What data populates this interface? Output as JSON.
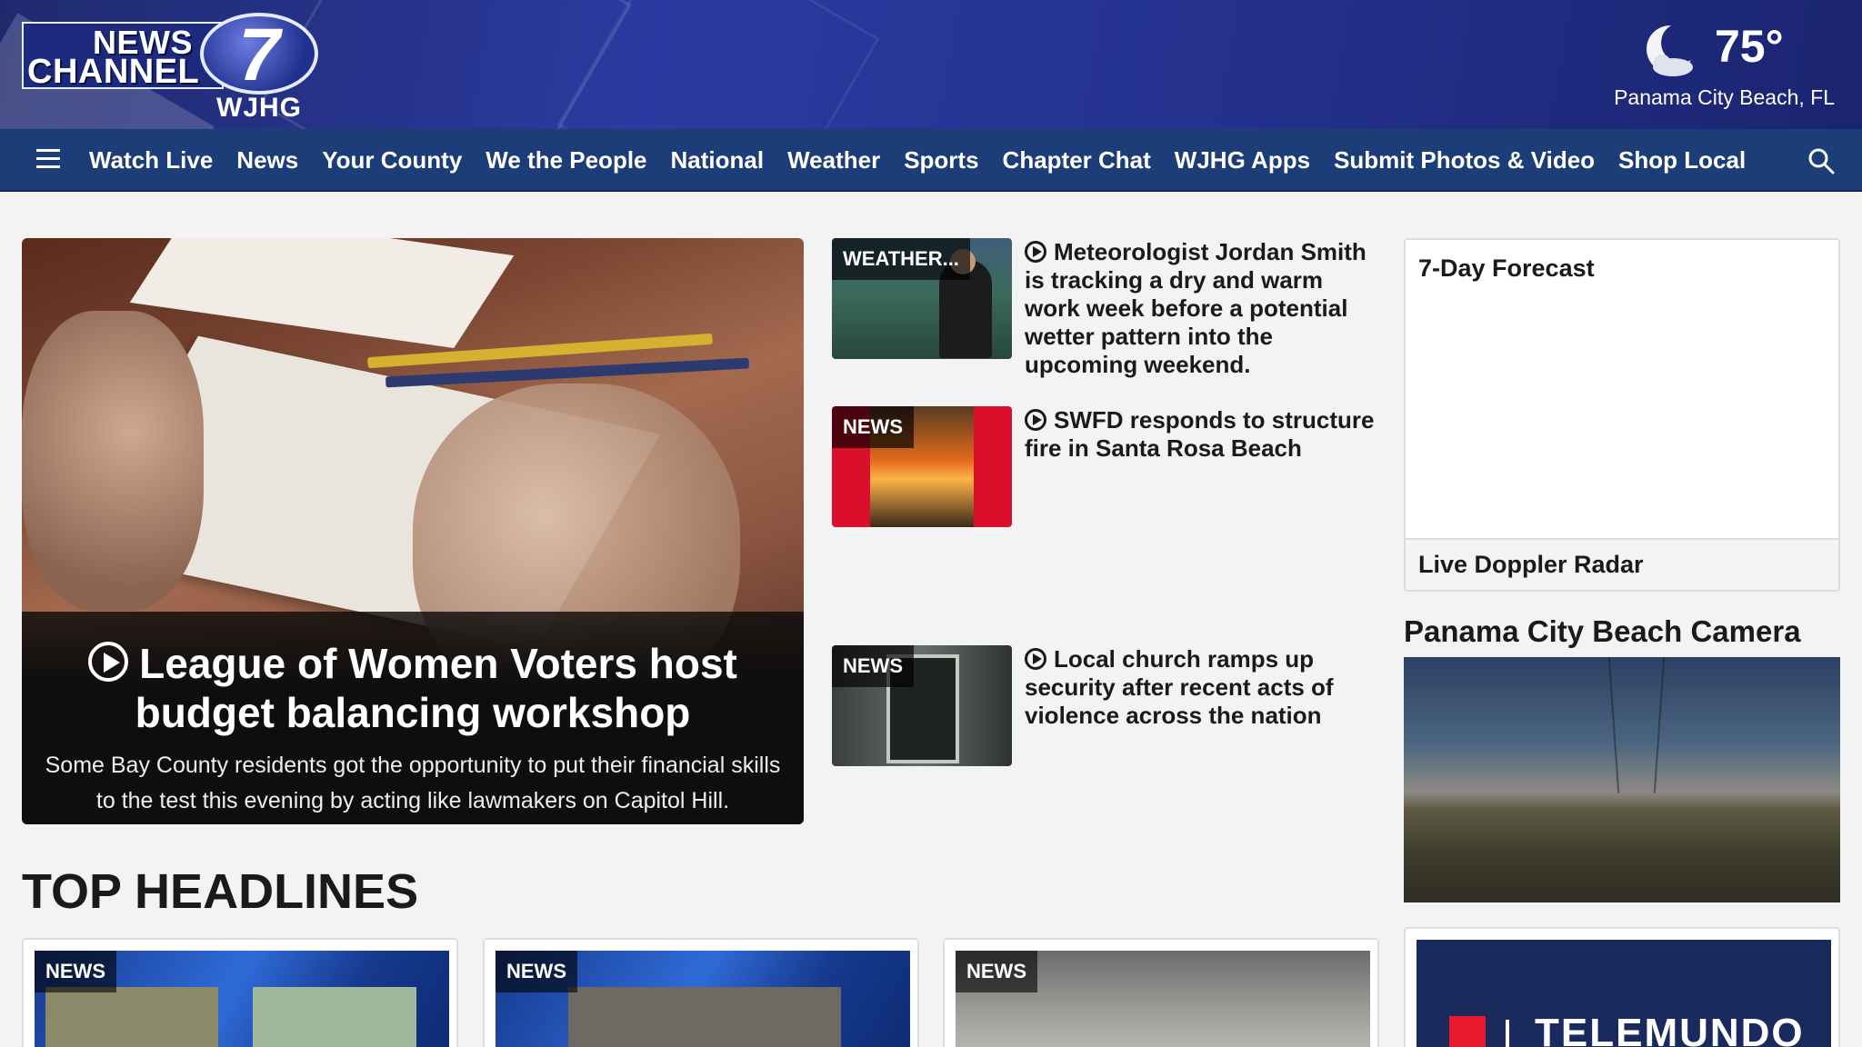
{
  "header": {
    "logo": {
      "line1": "NEWS",
      "line2": "CHANNEL",
      "number": "7",
      "callsign": "WJHG"
    },
    "weather": {
      "temperature": "75°",
      "location": "Panama City Beach, FL",
      "icon": "moon-cloud-icon"
    }
  },
  "nav": {
    "menu_icon": "hamburger-menu-icon",
    "items": [
      "Watch Live",
      "News",
      "Your County",
      "We the People",
      "National",
      "Weather",
      "Sports",
      "Chapter Chat",
      "WJHG Apps",
      "Submit Photos & Video",
      "Shop Local"
    ],
    "search_icon": "search-icon"
  },
  "hero": {
    "title": "League of Women Voters host budget balancing workshop",
    "summary": "Some Bay County residents got the opportunity to put their financial skills to the test this evening by acting like lawmakers on Capitol Hill.",
    "icon": "play-circle-icon"
  },
  "stories": [
    {
      "tag": "WEATHER...",
      "title": "Meteorologist Jordan Smith is tracking a dry and warm work week before a potential wetter pattern into the upcoming weekend."
    },
    {
      "tag": "NEWS",
      "title": "SWFD responds to structure fire in Santa Rosa Beach"
    },
    {
      "tag": "NEWS",
      "title": "Local church ramps up security after recent acts of violence across the nation"
    }
  ],
  "sidebar": {
    "forecast_title": "7-Day Forecast",
    "radar_label": "Live Doppler Radar",
    "camera_title": "Panama City Beach Camera"
  },
  "top_headlines": {
    "title": "TOP HEADLINES",
    "cards": [
      {
        "tag": "NEWS"
      },
      {
        "tag": "NEWS"
      },
      {
        "tag": "NEWS"
      }
    ],
    "telemundo": "TELEMUNDO"
  },
  "colors": {
    "nav": "#1c3d78",
    "masthead": "#2b3aa0",
    "telemundo_red": "#e8192c"
  }
}
